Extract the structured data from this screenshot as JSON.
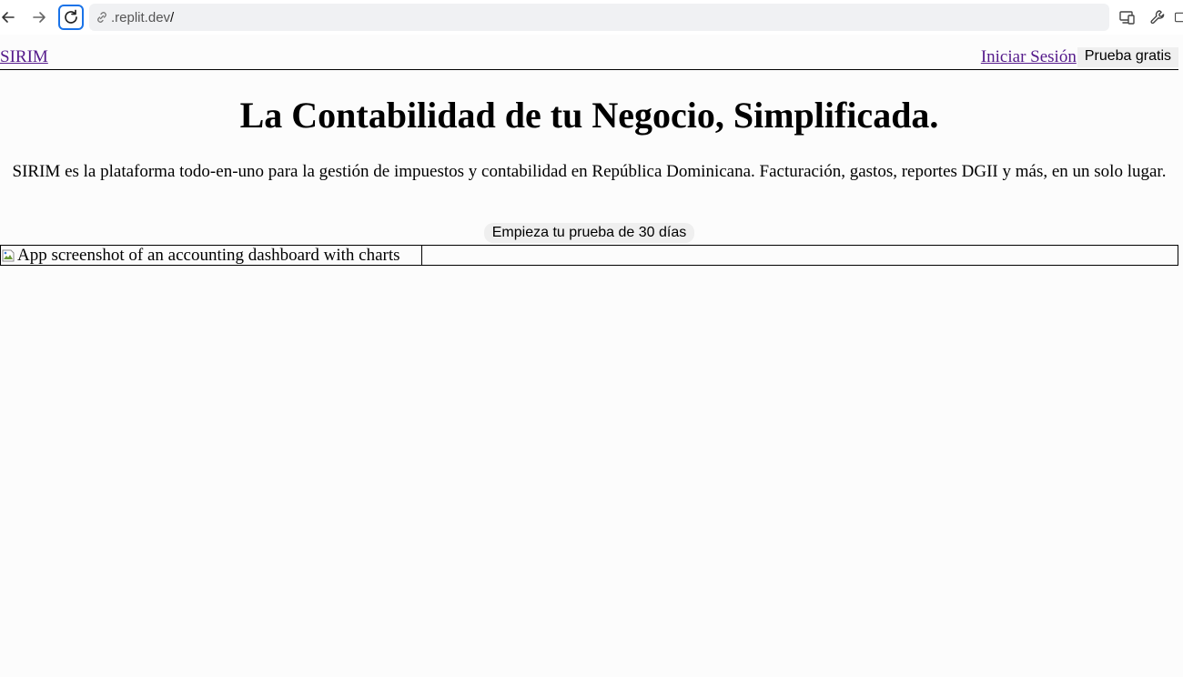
{
  "browser": {
    "url_prefix": ".replit.dev",
    "url_suffix": "/",
    "icons": {
      "back": "arrow-left-icon",
      "forward": "arrow-right-icon",
      "reload": "reload-icon",
      "link": "link-icon",
      "devices": "device-toolbar-icon",
      "tools": "wrench-icon"
    },
    "accent": "#1a73e8"
  },
  "nav": {
    "brand": "SIRIM",
    "login": "Iniciar Sesión",
    "trial": "Prueba gratis",
    "link_color": "#551a8b"
  },
  "hero": {
    "title": "La Contabilidad de tu Negocio, Simplificada.",
    "subtitle": "SIRIM es la plataforma todo-en-uno para la gestión de impuestos y contabilidad en República Dominicana. Facturación, gastos, reportes DGII y más, en un solo lugar.",
    "cta": "Empieza tu prueba de 30 días",
    "image_alt": "App screenshot of an accounting dashboard with charts"
  }
}
